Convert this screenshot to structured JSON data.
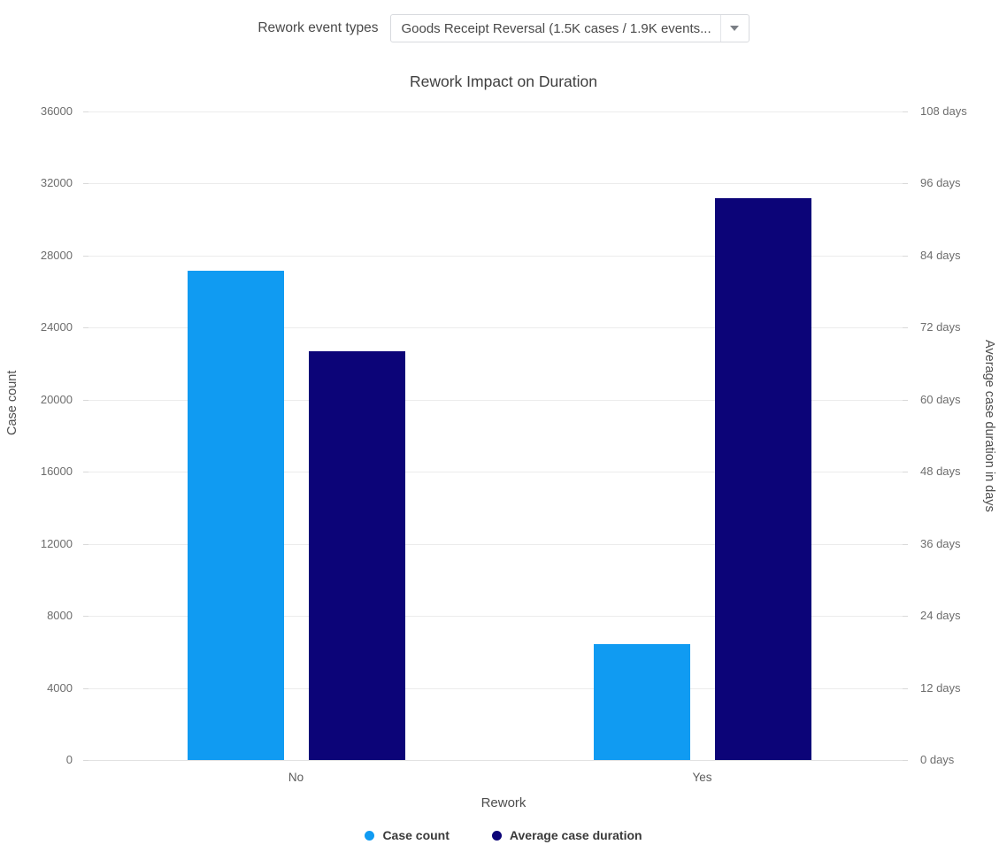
{
  "toolbar": {
    "filter_label": "Rework event types",
    "filter_value": "Goods Receipt Reversal (1.5K cases / 1.9K events...",
    "caret_icon": "chevron-down-icon"
  },
  "chart_data": {
    "type": "bar",
    "title": "Rework Impact on Duration",
    "xlabel": "Rework",
    "ylabel": "Case count",
    "y2label": "Average case duration in days",
    "categories": [
      "No",
      "Yes"
    ],
    "series": [
      {
        "name": "Case count",
        "axis": "left",
        "color": "#109BF2",
        "values": [
          27150,
          6430
        ]
      },
      {
        "name": "Average case duration",
        "axis": "right",
        "color": "#0C0478",
        "values": [
          68.1,
          93.6
        ]
      }
    ],
    "ylim": [
      0,
      36000
    ],
    "y2lim": [
      0,
      108
    ],
    "yticks": [
      0,
      4000,
      8000,
      12000,
      16000,
      20000,
      24000,
      28000,
      32000,
      36000
    ],
    "ytick_labels": [
      "0",
      "4000",
      "8000",
      "12000",
      "16000",
      "20000",
      "24000",
      "28000",
      "32000",
      "36000"
    ],
    "y2ticks": [
      0,
      12,
      24,
      36,
      48,
      60,
      72,
      84,
      96,
      108
    ],
    "y2tick_labels": [
      "0 days",
      "12 days",
      "24 days",
      "36 days",
      "48 days",
      "60 days",
      "72 days",
      "84 days",
      "96 days",
      "108 days"
    ],
    "grid": true,
    "legend_position": "bottom"
  },
  "legend": [
    {
      "label": "Case count",
      "color": "#109BF2"
    },
    {
      "label": "Average case duration",
      "color": "#0C0478"
    }
  ]
}
